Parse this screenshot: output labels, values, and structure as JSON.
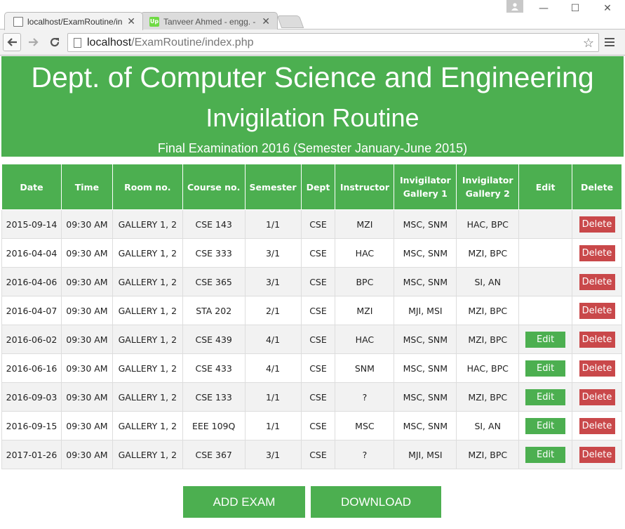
{
  "browser": {
    "tabs": [
      {
        "title": "localhost/ExamRoutine/in",
        "active": true
      },
      {
        "title": "Tanveer Ahmed - engg. - ",
        "active": false,
        "favicon_text": "Up"
      }
    ],
    "url_host": "localhost",
    "url_path": "/ExamRoutine/index.php",
    "window_controls": {
      "minimize": "—",
      "maximize": "☐",
      "close": "✕"
    }
  },
  "header": {
    "dept": "Dept. of Computer Science and Engineering",
    "title": "Invigilation Routine",
    "subtitle": "Final Examination 2016 (Semester January-June 2015)"
  },
  "table": {
    "columns": [
      "Date",
      "Time",
      "Room no.",
      "Course no.",
      "Semester",
      "Dept",
      "Instructor",
      "Invigilator Gallery 1",
      "Invigilator Gallery 2",
      "Edit",
      "Delete"
    ],
    "rows": [
      {
        "date": "2015-09-14",
        "time": "09:30 AM",
        "room": "GALLERY 1, 2",
        "course": "CSE 143",
        "semester": "1/1",
        "dept": "CSE",
        "instructor": "MZI",
        "inv1": "MSC, SNM",
        "inv2": "HAC, BPC",
        "edit": "",
        "delete": "Delete"
      },
      {
        "date": "2016-04-04",
        "time": "09:30 AM",
        "room": "GALLERY 1, 2",
        "course": "CSE 333",
        "semester": "3/1",
        "dept": "CSE",
        "instructor": "HAC",
        "inv1": "MSC, SNM",
        "inv2": "MZI, BPC",
        "edit": "",
        "delete": "Delete"
      },
      {
        "date": "2016-04-06",
        "time": "09:30 AM",
        "room": "GALLERY 1, 2",
        "course": "CSE 365",
        "semester": "3/1",
        "dept": "CSE",
        "instructor": "BPC",
        "inv1": "MSC, SNM",
        "inv2": "SI, AN",
        "edit": "",
        "delete": "Delete"
      },
      {
        "date": "2016-04-07",
        "time": "09:30 AM",
        "room": "GALLERY 1, 2",
        "course": "STA 202",
        "semester": "2/1",
        "dept": "CSE",
        "instructor": "MZI",
        "inv1": "MJI, MSI",
        "inv2": "MZI, BPC",
        "edit": "",
        "delete": "Delete"
      },
      {
        "date": "2016-06-02",
        "time": "09:30 AM",
        "room": "GALLERY 1, 2",
        "course": "CSE 439",
        "semester": "4/1",
        "dept": "CSE",
        "instructor": "HAC",
        "inv1": "MSC, SNM",
        "inv2": "MZI, BPC",
        "edit": "Edit",
        "delete": "Delete"
      },
      {
        "date": "2016-06-16",
        "time": "09:30 AM",
        "room": "GALLERY 1, 2",
        "course": "CSE 433",
        "semester": "4/1",
        "dept": "CSE",
        "instructor": "SNM",
        "inv1": "MSC, SNM",
        "inv2": "HAC, BPC",
        "edit": "Edit",
        "delete": "Delete"
      },
      {
        "date": "2016-09-03",
        "time": "09:30 AM",
        "room": "GALLERY 1, 2",
        "course": "CSE 133",
        "semester": "1/1",
        "dept": "CSE",
        "instructor": "?",
        "inv1": "MSC, SNM",
        "inv2": "MZI, BPC",
        "edit": "Edit",
        "delete": "Delete"
      },
      {
        "date": "2016-09-15",
        "time": "09:30 AM",
        "room": "GALLERY 1, 2",
        "course": "EEE 109Q",
        "semester": "1/1",
        "dept": "CSE",
        "instructor": "MSC",
        "inv1": "MSC, SNM",
        "inv2": "SI, AN",
        "edit": "Edit",
        "delete": "Delete"
      },
      {
        "date": "2017-01-26",
        "time": "09:30 AM",
        "room": "GALLERY 1, 2",
        "course": "CSE 367",
        "semester": "3/1",
        "dept": "CSE",
        "instructor": "?",
        "inv1": "MJI, MSI",
        "inv2": "MZI, BPC",
        "edit": "Edit",
        "delete": "Delete"
      }
    ]
  },
  "actions": {
    "add_label": "ADD EXAM",
    "download_label": "DOWNLOAD"
  },
  "colors": {
    "primary_green": "#4caf50",
    "delete_red": "#c9484a"
  }
}
